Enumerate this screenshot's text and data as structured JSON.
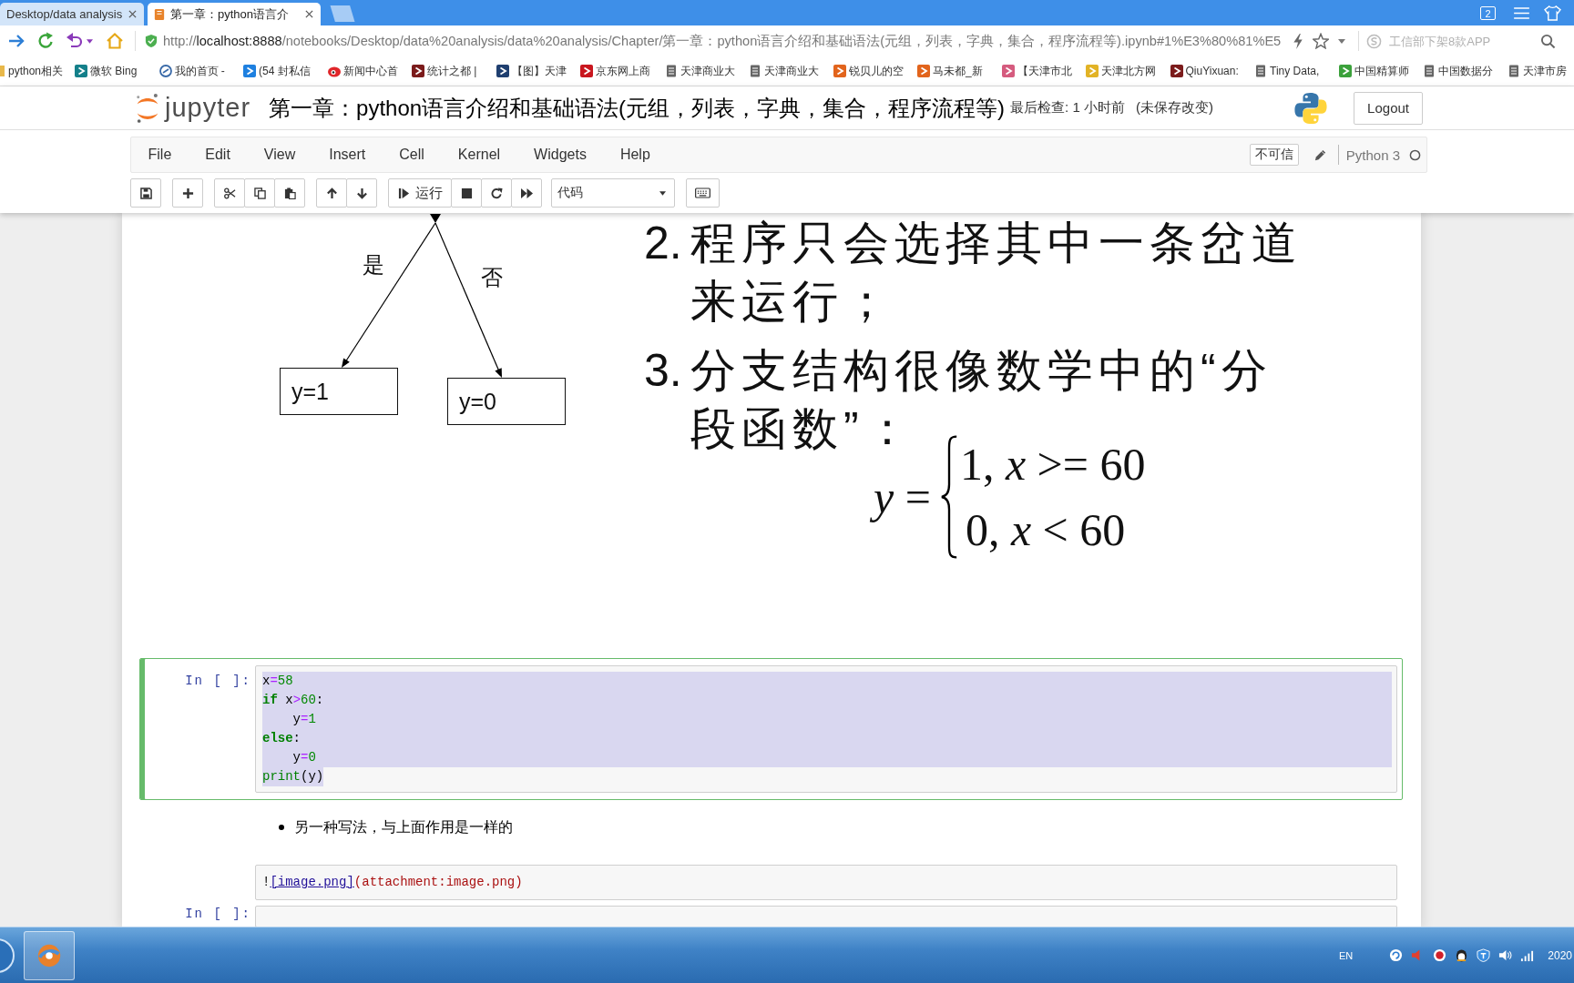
{
  "browser": {
    "tabs": [
      {
        "title": "Desktop/data analysis",
        "selected": false
      },
      {
        "title": "第一章：python语言介",
        "selected": true
      }
    ],
    "tab_count": "2",
    "address": "http://**localhost:8888**/notebooks/Desktop/data%20analysis/data%20analysis/Chapter/第一章：python语言介绍和基础语法(元组，列表，字典，集合，程序流程等).ipynb#1%E3%80%81%E5",
    "search": {
      "placeholder": "工信部下架8款APP"
    },
    "bookmarks": [
      "python相关",
      "微软 Bing",
      "我的首页 -",
      "(54 封私信",
      "新闻中心首",
      "统计之都 |",
      "【图】天津",
      "京东网上商",
      "天津商业大",
      "天津商业大",
      "锐贝儿的空",
      "马未都_新",
      "【天津市北",
      "天津北方网",
      "QiuYixuan:",
      "Tiny Data,",
      "中国精算师",
      "中国数据分",
      "天津市房"
    ]
  },
  "jupyter": {
    "logo_text": "jupyter",
    "title": "第一章：python语言介绍和基础语法(元组，列表，字典，集合，程序流程等)",
    "checkpoint": "最后检查: 1 小时前",
    "autosave": "(未保存改变)",
    "logout": "Logout",
    "menu": [
      "File",
      "Edit",
      "View",
      "Insert",
      "Cell",
      "Kernel",
      "Widgets",
      "Help"
    ],
    "trust": "不可信",
    "edit_mode": true,
    "kernel": {
      "name": "Python 3",
      "busy": false
    },
    "toolbar": {
      "run": "运行",
      "cell_type": "代码"
    }
  },
  "notebook": {
    "slide": {
      "flowchart": {
        "branch_labels": [
          "是",
          "否"
        ],
        "boxes": [
          "y=1",
          "y=0"
        ]
      },
      "points": [
        {
          "number": "2.",
          "lines": [
            "程序只会选择其中一条岔道",
            "来运行；"
          ]
        },
        {
          "number": "3.",
          "lines": [
            "分支结构很像数学中的“分",
            "段函数”："
          ]
        }
      ],
      "formula": {
        "lhs": "*y* =",
        "cases": [
          "1, *x* >= 60",
          "0, *x* < 60"
        ]
      }
    },
    "code_cell": {
      "prompt": "In [ ]:",
      "selected": true,
      "text_selected": true,
      "lines": [
        {
          "tokens": [
            {
              "text": "x",
              "kind": "variable"
            },
            {
              "text": "=",
              "kind": "operator"
            },
            {
              "text": "58",
              "kind": "number"
            }
          ]
        },
        {
          "tokens": [
            {
              "text": "if",
              "kind": "keyword"
            },
            {
              "text": " x",
              "kind": "variable"
            },
            {
              "text": ">",
              "kind": "operator"
            },
            {
              "text": "60",
              "kind": "number"
            },
            {
              "text": ":",
              "kind": "punctuation"
            }
          ]
        },
        {
          "tokens": [
            {
              "text": "    y",
              "kind": "variable"
            },
            {
              "text": "=",
              "kind": "operator"
            },
            {
              "text": "1",
              "kind": "number"
            }
          ]
        },
        {
          "tokens": [
            {
              "text": "else",
              "kind": "keyword"
            },
            {
              "text": ":",
              "kind": "punctuation"
            }
          ]
        },
        {
          "tokens": [
            {
              "text": "    y",
              "kind": "variable"
            },
            {
              "text": "=",
              "kind": "operator"
            },
            {
              "text": "0",
              "kind": "number"
            }
          ]
        },
        {
          "tokens": [
            {
              "text": "print",
              "kind": "builtin"
            },
            {
              "text": "(y)",
              "kind": "punctuation"
            }
          ]
        }
      ]
    },
    "bullets": [
      "另一种写法，与上面作用是一样的"
    ],
    "markdown_source": [
      {
        "text": "!",
        "kind": "punctuation"
      },
      {
        "text": "[image.png]",
        "kind": "link"
      },
      {
        "text": "(attachment:image.png)",
        "kind": "url"
      }
    ],
    "next_cell": {
      "prompt": "In [ ]:"
    }
  },
  "taskbar": {
    "language": "EN",
    "clock": "2020"
  }
}
